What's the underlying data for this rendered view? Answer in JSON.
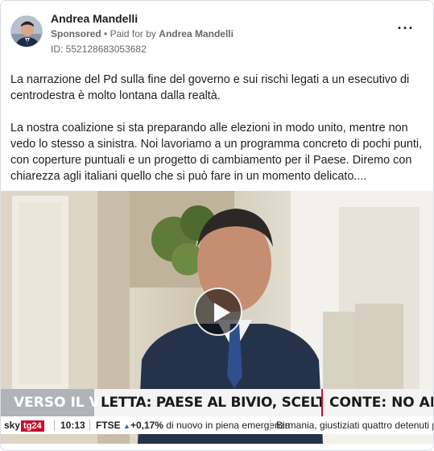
{
  "post": {
    "author": "Andrea Mandelli",
    "sponsored_label": "Sponsored",
    "bullet": "•",
    "paid_for_prefix": "Paid for by",
    "paid_for_name": "Andrea Mandelli",
    "ad_id": "ID: 552128683053682",
    "more_icon": "more-horizontal-icon",
    "more_label": "···",
    "paragraphs": [
      "La narrazione del Pd sulla fine del governo e sui rischi legati a un esecutivo di centrodestra è molto lontana dalla realtà.",
      "La nostra coalizione si sta preparando alle elezioni in modo unito, mentre non vedo lo stesso a sinistra. Noi lavoriamo a un programma concreto di pochi punti, con coperture puntuali e un progetto di cambiamento per il Paese. Diremo con chiarezza agli italiani quello che si può fare in un momento delicato...."
    ]
  },
  "video": {
    "play_icon": "play-icon",
    "ticker": {
      "tag": "VERSO IL VOTO",
      "headline": "LETTA: PAESE AL BIVIO, SCELTA TRA NOI E M",
      "headline2": "CONTE: NO AD ARI",
      "channel_sky": "sky",
      "channel_tg": "tg24",
      "time": "10:13",
      "ftse_label": "FTSE",
      "ftse_arrow": "▲",
      "ftse_value": "+0,17%",
      "ftse_text": "di nuovo in piena emergenza",
      "news": "Birmania, giustiziati quattro detenuti politi"
    }
  },
  "colors": {
    "accent_red": "#c8102e",
    "meta_gray": "#65676b",
    "text": "#1c1e21"
  }
}
